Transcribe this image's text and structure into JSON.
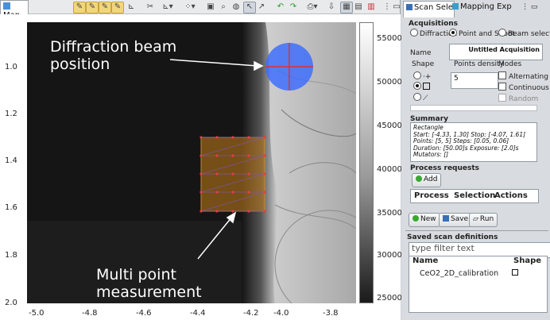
{
  "map_view": {
    "tab_label": "Map",
    "y_ticks": [
      "1.0",
      "1.2",
      "1.4",
      "1.6",
      "1.8",
      "2.0"
    ],
    "x_ticks": [
      "-5.0",
      "-4.8",
      "-4.6",
      "-4.4",
      "-4.2",
      "-4.0",
      "-3.8"
    ],
    "colorbar_ticks": [
      "55000",
      "50000",
      "45000",
      "40000",
      "35000",
      "30000",
      "25000"
    ],
    "annotations": {
      "beam": [
        "Diffraction beam",
        "position"
      ],
      "multi": [
        "Multi point",
        "measurement"
      ]
    },
    "colors": {
      "beam_marker": "#3a6bff",
      "scan_region": "#b8741a",
      "grid_points": "#ff3030"
    },
    "toolbar_icons": [
      "pen-icon",
      "pen-icon",
      "pen-icon",
      "pen-icon",
      "axes-icon",
      "tools-icon",
      "plot-menu-icon",
      "scatter-menu-icon",
      "select-roi-icon",
      "zoom-icon",
      "mask-icon",
      "pointer-icon",
      "pan-icon",
      "undo-icon",
      "redo-icon",
      "print-icon",
      "export-icon",
      "aspect-icon",
      "grid-icon",
      "colorbar-icon",
      "menu-icon",
      "minimize-icon",
      "maximize-icon"
    ]
  },
  "scan_panel": {
    "tabs": [
      "Scan Selecti",
      "Mapping Exp"
    ],
    "acquisitions": {
      "title": "Acquisitions",
      "modes": [
        "Diffraction",
        "Point and Shoot",
        "Beam selector"
      ],
      "selected_mode": "Point and Shoot"
    },
    "name": {
      "label": "Name",
      "value": "Untitled Acquisition"
    },
    "shape_label": "Shape",
    "points_density_label": "Points density",
    "points_density_value": "5",
    "modes_label": "Modes",
    "mode_checks": [
      "Alternating",
      "Continuous",
      "Random"
    ],
    "summary": {
      "title": "Summary",
      "lines": [
        "Rectangle",
        "Start: [-4.33, 1.30] Stop: [-4.07, 1.61]",
        "Points: [5, 5] Steps: [0.05, 0.06]",
        "Duration: [50.00]s Exposure: [2.0]s",
        "Mutators: []"
      ]
    },
    "process_requests": {
      "title": "Process requests",
      "add_label": "Add",
      "columns": [
        "Process",
        "Selection",
        "Actions"
      ]
    },
    "buttons": {
      "new": "New",
      "save": "Save",
      "run": "Run"
    },
    "saved": {
      "title": "Saved scan definitions",
      "filter_placeholder": "type filter text",
      "columns": [
        "Name",
        "Shape"
      ],
      "rows": [
        {
          "name": "CeO2_2D_calibration"
        }
      ]
    }
  }
}
